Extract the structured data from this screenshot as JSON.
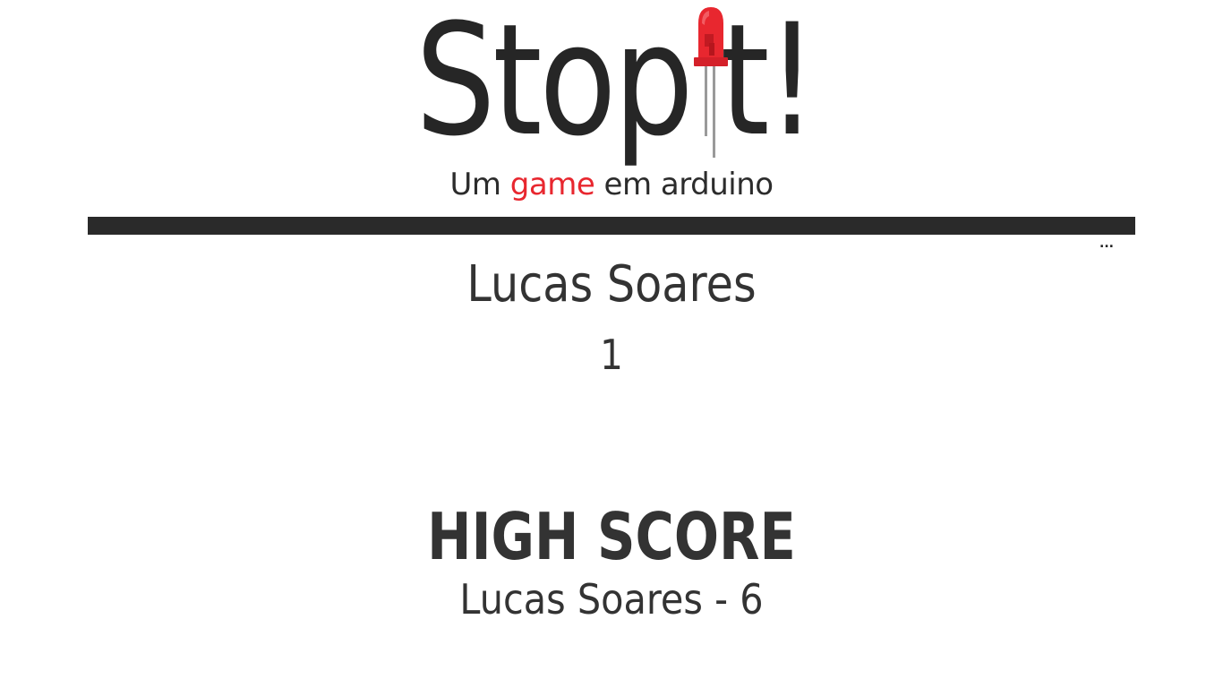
{
  "logo": {
    "word_before": "Stop",
    "word_after": "t!",
    "led_icon": "red-led-icon",
    "led_color": "#e8272f"
  },
  "subtitle": {
    "before": "Um ",
    "accent": "game",
    "after": " em arduino",
    "accent_color": "#e8272f"
  },
  "progress": {
    "bar_color": "#2a2a2a",
    "overflow_indicator": "..."
  },
  "current_player": {
    "name": "Lucas Soares",
    "score": "1"
  },
  "high_score": {
    "title": "HIGH SCORE",
    "value": "Lucas Soares - 6"
  }
}
